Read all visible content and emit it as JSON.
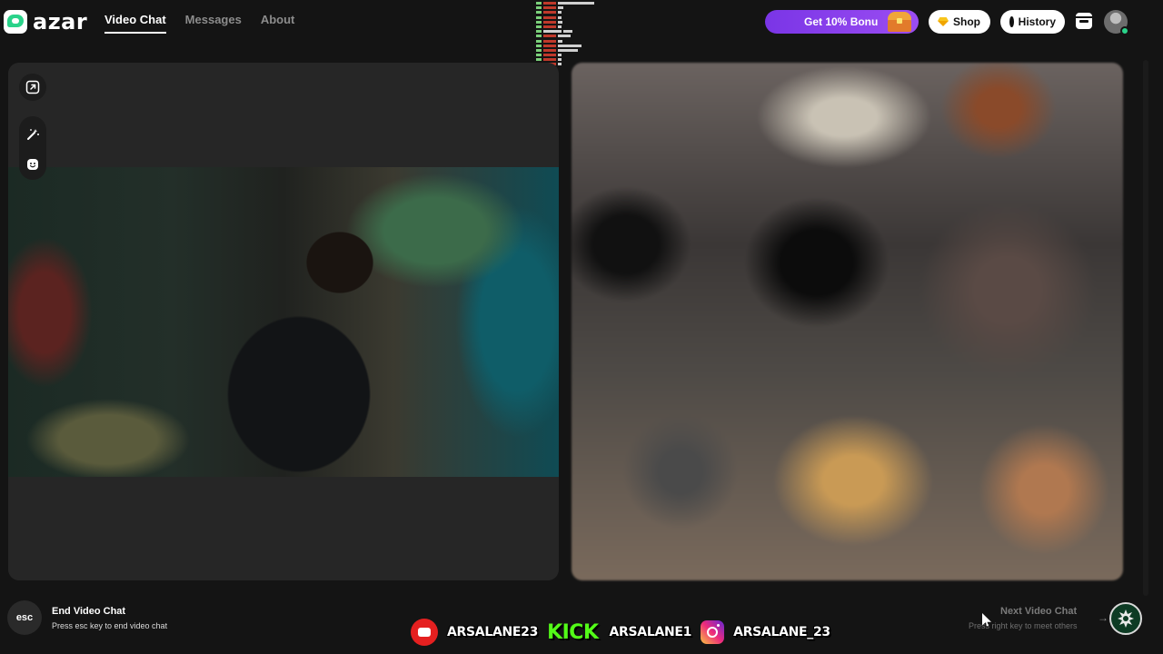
{
  "app": {
    "logo_text": "azar"
  },
  "nav": {
    "items": [
      {
        "label": "Video Chat",
        "active": true
      },
      {
        "label": "Messages",
        "active": false
      },
      {
        "label": "About",
        "active": false
      }
    ]
  },
  "header": {
    "bonus_label": "Get 10% Bonu",
    "shop_label": "Shop",
    "history_label": "History",
    "icons": {
      "bonus": "treasure-chest-icon",
      "shop": "gem-icon",
      "history": "clock-icon",
      "inbox": "inbox-icon",
      "avatar": "user-avatar"
    }
  },
  "panel_tools": {
    "icons": [
      "expand-icon",
      "magic-wand-icon",
      "face-sticker-icon"
    ]
  },
  "footer": {
    "end": {
      "key": "esc",
      "title": "End Video Chat",
      "hint": "Press esc key to end video chat"
    },
    "next": {
      "title": "Next Video Chat",
      "hint": "Press right key to meet others",
      "key_icon": "arrow-right-icon"
    }
  },
  "overlay": {
    "youtube_handle": "ARSALANE23",
    "kick_logo": "KICK",
    "kick_handle": "ARSALANE1",
    "instagram_handle": "ARSALANE_23"
  },
  "colors": {
    "accent_purple": "#8a3fed",
    "kick_green": "#53fc18",
    "youtube_red": "#e52020",
    "background": "#141414",
    "panel": "#262626"
  }
}
